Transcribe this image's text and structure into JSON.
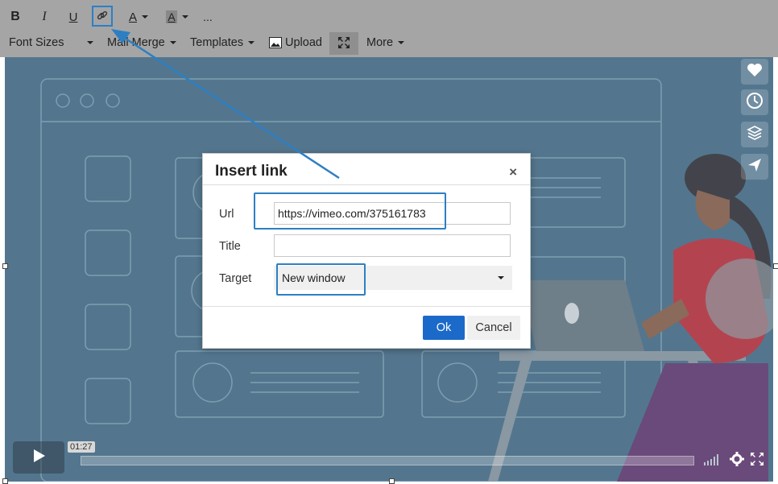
{
  "toolbar": {
    "bold_label": "B",
    "italic_label": "I",
    "underline_label": "U",
    "link_icon": "link-icon",
    "font_color_label": "A",
    "bg_color_label": "A",
    "more_dots": "...",
    "font_sizes": "Font Sizes",
    "mail_merge": "Mail Merge",
    "templates": "Templates",
    "upload": "Upload",
    "fullscreen_icon": "fullscreen-icon",
    "more": "More"
  },
  "dialog": {
    "title": "Insert link",
    "close": "×",
    "url_label": "Url",
    "url_value": "https://vimeo.com/375161783",
    "title_label": "Title",
    "title_value": "",
    "target_label": "Target",
    "target_value": "New window",
    "ok": "Ok",
    "cancel": "Cancel"
  },
  "player": {
    "time": "01:27"
  },
  "side_icons": [
    "heart-icon",
    "clock-icon",
    "layers-icon",
    "send-icon"
  ],
  "colors": {
    "toolbar_bg": "#a5a5a5",
    "video_bg": "#53768e",
    "accent": "#1b6ac9",
    "highlight": "#2d7fc4"
  }
}
